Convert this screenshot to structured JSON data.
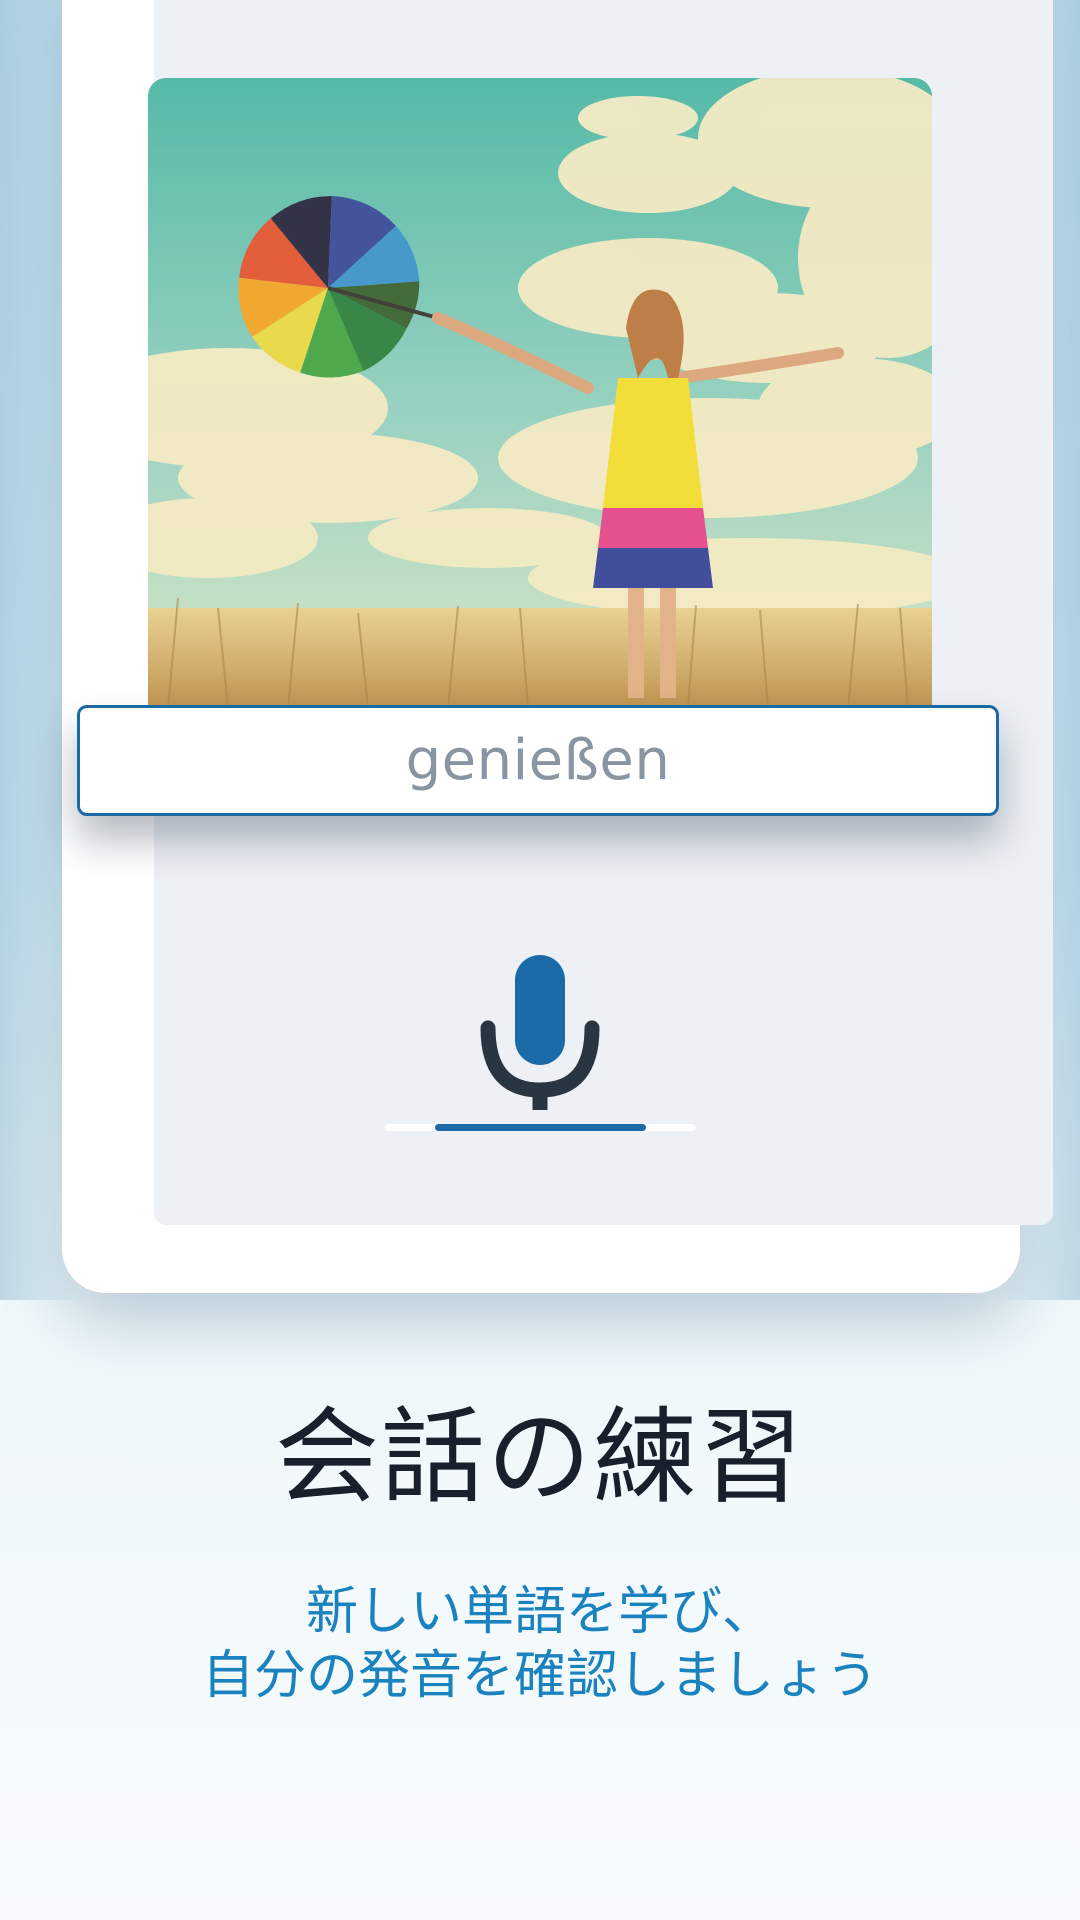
{
  "card": {
    "image_alt": "Woman in a yellow dress holding a rainbow umbrella in a sunny field",
    "word": "genießen"
  },
  "recorder": {
    "icon": "microphone-icon",
    "progress": 0.68,
    "accent_color": "#1b6aa8"
  },
  "feature": {
    "title": "会話の練習",
    "subtitle_line1": "新しい単語を学び、",
    "subtitle_line2": "自分の発音を確認しましょう"
  }
}
